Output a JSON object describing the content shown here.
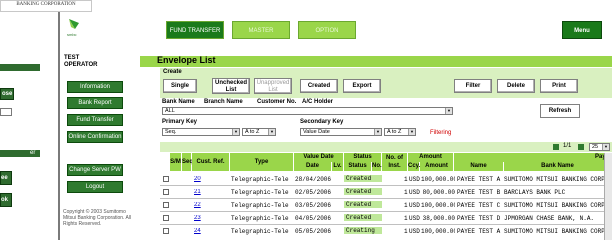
{
  "bg": {
    "corporation": "BANKING CORPORATION",
    "close_label": "ose",
    "er_label": "er",
    "ee_label": "ee",
    "ok_label": "ok"
  },
  "nav": {
    "user_line1": "TEST",
    "user_line2": "OPERATOR",
    "items": [
      "Information",
      "Bank Report",
      "Fund Transfer",
      "Online Confirmation",
      "Change Server PW",
      "Logout"
    ],
    "copyright": "Copyright © 2003 Sumitomo Mitsui Banking Corporation. All Rights Reserved."
  },
  "tabs": [
    "FUND TRANSFER",
    "MASTER",
    "OPTION"
  ],
  "menu_label": "Menu",
  "page_title": "Envelope List",
  "create": {
    "label": "Create",
    "single": "Single",
    "unchecked_list": "Unchecked List",
    "unapproved_list": "Unapproved List",
    "created": "Created",
    "export": "Export",
    "filter": "Filter",
    "delete": "Delete",
    "print": "Print"
  },
  "filters": {
    "bank_name_hdr": "Bank Name",
    "branch_name_hdr": "Branch Name",
    "customer_no_hdr": "Customer No.",
    "ac_holder_hdr": "A/C Holder",
    "bank_value": "ALL",
    "primary_key_lbl": "Primary Key",
    "primary_key_value": "Seq.",
    "primary_order": "A to Z",
    "secondary_key_lbl": "Secondary Key",
    "secondary_key_value": "Value Date",
    "secondary_order": "A to Z",
    "filtering": "Filtering",
    "refresh": "Refresh"
  },
  "pager": {
    "page": "1/1",
    "per_page": "25"
  },
  "table": {
    "headers": {
      "sm": "S/M",
      "seq": "Seq.",
      "cust_ref": "Cust. Ref.",
      "type": "Type",
      "value_date": "Value Date",
      "date": "Date",
      "lv": "Lv.",
      "status": "Status",
      "status_sub": "Status",
      "no": "No.",
      "no_of_inst": "No. of Inst.",
      "amount": "Amount",
      "ccy": "Ccy.",
      "amount_sub": "Amount",
      "payee": "Paye",
      "name": "Name",
      "bank_name": "Bank Name"
    },
    "rows": [
      {
        "seq": "20",
        "type": "Telegraphic-Tele",
        "date": "28/04/2006",
        "status": "Created",
        "inst": "1",
        "ccy": "USD",
        "amount": "100,000.00",
        "name": "PAYEE TEST A",
        "bank": "SUMITOMO MITSUI BANKING CORP"
      },
      {
        "seq": "21",
        "type": "Telegraphic-Tele",
        "date": "02/05/2006",
        "status": "Created",
        "inst": "1",
        "ccy": "USD",
        "amount": "80,000.00",
        "name": "PAYEE TEST B",
        "bank": "BARCLAYS BANK PLC"
      },
      {
        "seq": "22",
        "type": "Telegraphic-Tele",
        "date": "03/05/2006",
        "status": "Created",
        "inst": "1",
        "ccy": "USD",
        "amount": "100,000.00",
        "name": "PAYEE TEST C",
        "bank": "SUMITOMO MITSUI BANKING CORP"
      },
      {
        "seq": "23",
        "type": "Telegraphic-Tele",
        "date": "04/05/2006",
        "status": "Created",
        "inst": "1",
        "ccy": "USD",
        "amount": "38,000.00",
        "name": "PAYEE TEST D",
        "bank": "JPMORGAN CHASE BANK, N.A."
      },
      {
        "seq": "24",
        "type": "Telegraphic-Tele",
        "date": "05/05/2006",
        "status": "Creating",
        "inst": "1",
        "ccy": "USD",
        "amount": "100,000.00",
        "name": "PAYEE TEST A",
        "bank": "SUMITOMO MITSUI BANKING CORP"
      }
    ]
  },
  "colors": {
    "accent_dark": "#1a7a1a",
    "accent_light": "#9ad64a",
    "panel": "#d9f0c0",
    "filtering_red": "#d00000"
  }
}
